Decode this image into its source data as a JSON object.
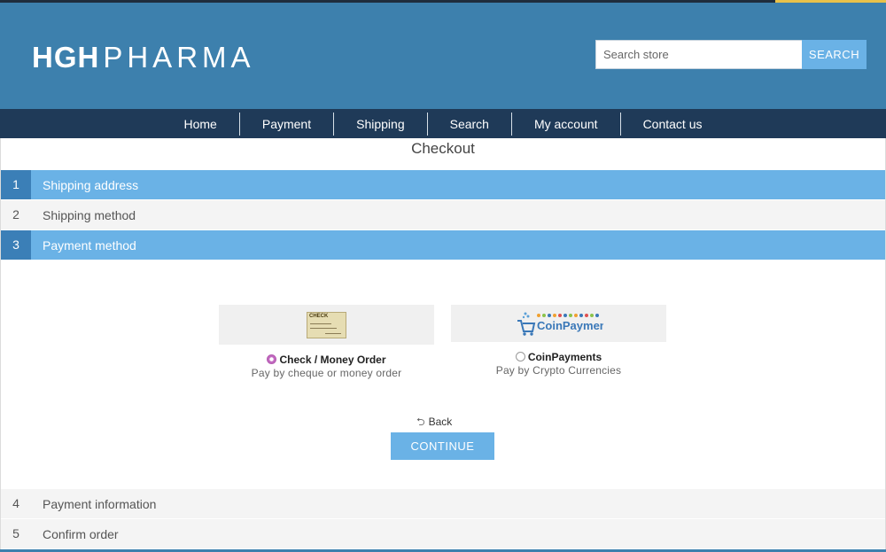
{
  "brand": {
    "bold": "HGH",
    "thin": "PHARMA"
  },
  "search": {
    "placeholder": "Search store",
    "button_label": "SEARCH"
  },
  "nav": [
    "Home",
    "Payment",
    "Shipping",
    "Search",
    "My account",
    "Contact us"
  ],
  "page_title": "Checkout",
  "steps": [
    {
      "num": "1",
      "label": "Shipping address",
      "state": "active"
    },
    {
      "num": "2",
      "label": "Shipping method",
      "state": "inactive"
    },
    {
      "num": "3",
      "label": "Payment method",
      "state": "active"
    },
    {
      "num": "4",
      "label": "Payment information",
      "state": "inactive"
    },
    {
      "num": "5",
      "label": "Confirm order",
      "state": "inactive"
    }
  ],
  "payment_options": [
    {
      "name": "Check / Money Order",
      "description": "Pay by cheque or money order",
      "selected": true,
      "image_text": "CHECK"
    },
    {
      "name": "CoinPayments",
      "description": "Pay by Crypto Currencies",
      "selected": false,
      "image_text": "CoinPayments"
    }
  ],
  "back_label": "Back",
  "continue_label": "CONTINUE",
  "colors": {
    "header_bg": "#3d80ad",
    "nav_bg": "#1f3a58",
    "accent": "#6ab2e6",
    "active_step_num": "#3b7fb7",
    "selected_radio": "#c26ac0"
  }
}
